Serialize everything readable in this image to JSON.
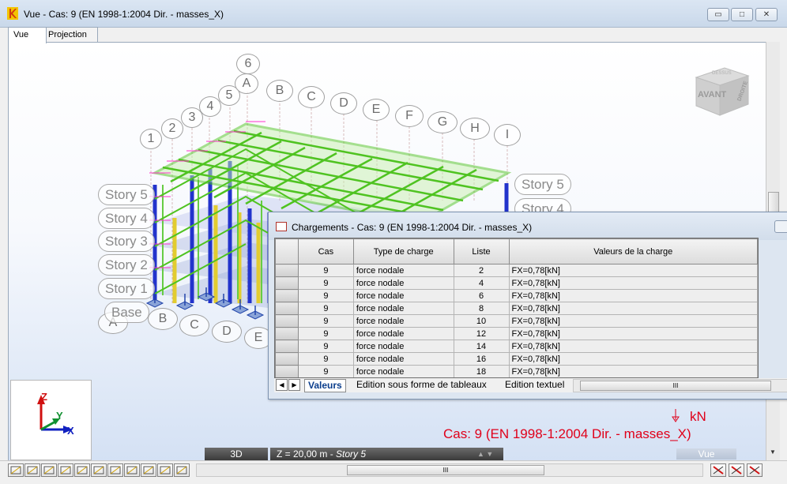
{
  "window": {
    "title": "Vue - Cas: 9 (EN 1998-1:2004 Dir. - masses_X)",
    "minimize_glyph": "▭",
    "maximize_glyph": "□",
    "close_glyph": "✕"
  },
  "tabs": [
    {
      "label": "Vue",
      "active": true
    },
    {
      "label": "Projection",
      "active": false
    }
  ],
  "view_cube": {
    "front": "AVANT",
    "side": "DROITE",
    "top": "DESSUS"
  },
  "grid_labels": {
    "numbers": [
      "1",
      "2",
      "3",
      "4",
      "5",
      "6"
    ],
    "letters_top": [
      "A",
      "B",
      "C",
      "D",
      "E",
      "F",
      "G",
      "H",
      "I"
    ],
    "letters_bottom": [
      "A",
      "B",
      "C",
      "D",
      "E"
    ]
  },
  "story_labels_left": [
    "Story 5",
    "Story 4",
    "Story 3",
    "Story 2",
    "Story 1",
    "Base"
  ],
  "story_labels_right": [
    "Story 5",
    "Story 4"
  ],
  "axes": {
    "x": "X",
    "y": "Y",
    "z": "Z"
  },
  "legend": {
    "unit": "kN",
    "case": "Cas: 9 (EN 1998-1:2004 Dir. - masses_X)",
    "color": "#e0001a"
  },
  "status": {
    "mode_3d": "3D",
    "z_level_prefix": "Z = 20,00 m - ",
    "z_level_story": "Story 5",
    "right_pill": "Vue"
  },
  "loads_window": {
    "title": "Chargements - Cas: 9 (EN 1998-1:2004 Dir. - masses_X)",
    "columns": [
      "Cas",
      "Type de charge",
      "Liste",
      "Valeurs de la charge"
    ],
    "rows": [
      {
        "cas": "9",
        "type": "force nodale",
        "liste": "2",
        "valeur": "FX=0,78[kN]"
      },
      {
        "cas": "9",
        "type": "force nodale",
        "liste": "4",
        "valeur": "FX=0,78[kN]"
      },
      {
        "cas": "9",
        "type": "force nodale",
        "liste": "6",
        "valeur": "FX=0,78[kN]"
      },
      {
        "cas": "9",
        "type": "force nodale",
        "liste": "8",
        "valeur": "FX=0,78[kN]"
      },
      {
        "cas": "9",
        "type": "force nodale",
        "liste": "10",
        "valeur": "FX=0,78[kN]"
      },
      {
        "cas": "9",
        "type": "force nodale",
        "liste": "12",
        "valeur": "FX=0,78[kN]"
      },
      {
        "cas": "9",
        "type": "force nodale",
        "liste": "14",
        "valeur": "FX=0,78[kN]"
      },
      {
        "cas": "9",
        "type": "force nodale",
        "liste": "16",
        "valeur": "FX=0,78[kN]"
      },
      {
        "cas": "9",
        "type": "force nodale",
        "liste": "18",
        "valeur": "FX=0,78[kN]"
      }
    ],
    "sheet_tabs": [
      "Valeurs",
      "Edition sous forme de tableaux",
      "Edition textuel"
    ],
    "nav_prev": "◀",
    "nav_next": "▶",
    "scroll_grip": "III"
  },
  "main_scroll_grip": "III",
  "icons": {
    "app": "robot-logo-icon",
    "loads": "table-window-icon",
    "toolbar": [
      "node-icon",
      "bar-icon",
      "grid-number-icon",
      "support-icon",
      "load-icon",
      "member-icon",
      "panel-icon",
      "slab-icon",
      "label-icon",
      "table-icon",
      "copy-icon"
    ],
    "right_toolbar": [
      "delete-icon",
      "measure-icon",
      "view-icon"
    ]
  }
}
